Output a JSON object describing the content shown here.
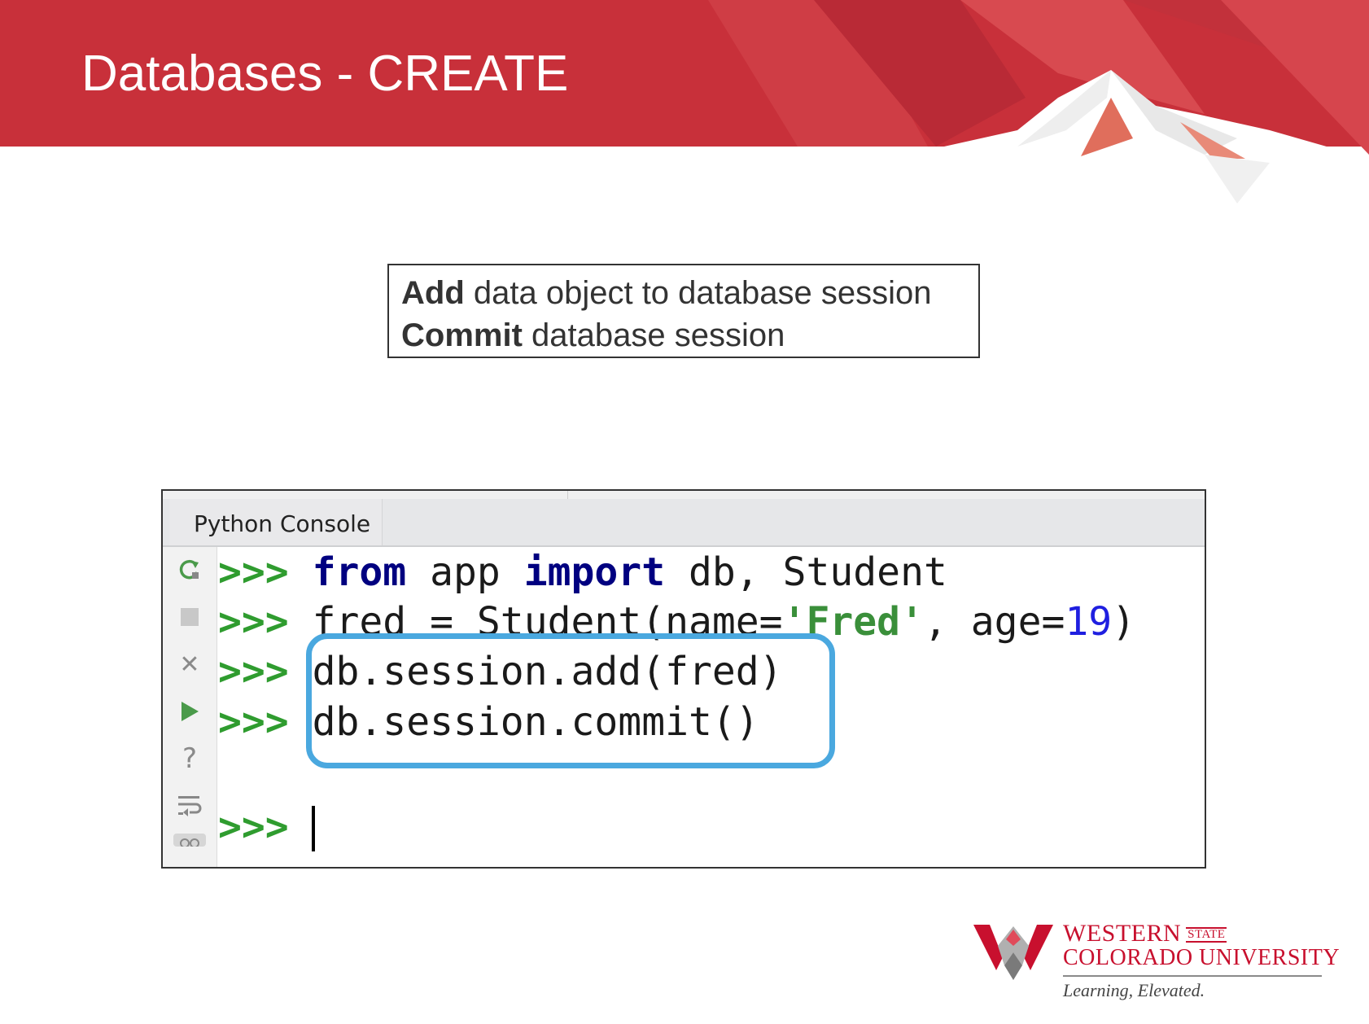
{
  "slide": {
    "title": "Databases - CREATE"
  },
  "note": {
    "line1_bold": "Add",
    "line1_rest": " data object to database session",
    "line2_bold": "Commit",
    "line2_rest": " database session"
  },
  "console": {
    "tab_label": "Python Console",
    "prompt": ">>>",
    "lines": [
      {
        "kw1": "from",
        "t1": " app ",
        "kw2": "import",
        "t2": " db, Student"
      },
      {
        "t1": "fred = Student(name=",
        "str": "'Fred'",
        "t2": ", age=",
        "num": "19",
        "t3": ")"
      },
      {
        "t1": "db.session.add(fred)"
      },
      {
        "t1": "db.session.commit()"
      }
    ],
    "gutter_icons": [
      "rerun-icon",
      "stop-icon",
      "close-icon",
      "run-icon",
      "help-icon",
      "soft-wrap-icon"
    ],
    "highlight_color": "#4aa8df"
  },
  "logo": {
    "line1": "WESTERN",
    "state": "STATE",
    "line2": "COLORADO UNIVERSITY",
    "tagline": "Learning, Elevated.",
    "brand_color": "#c8102e"
  }
}
